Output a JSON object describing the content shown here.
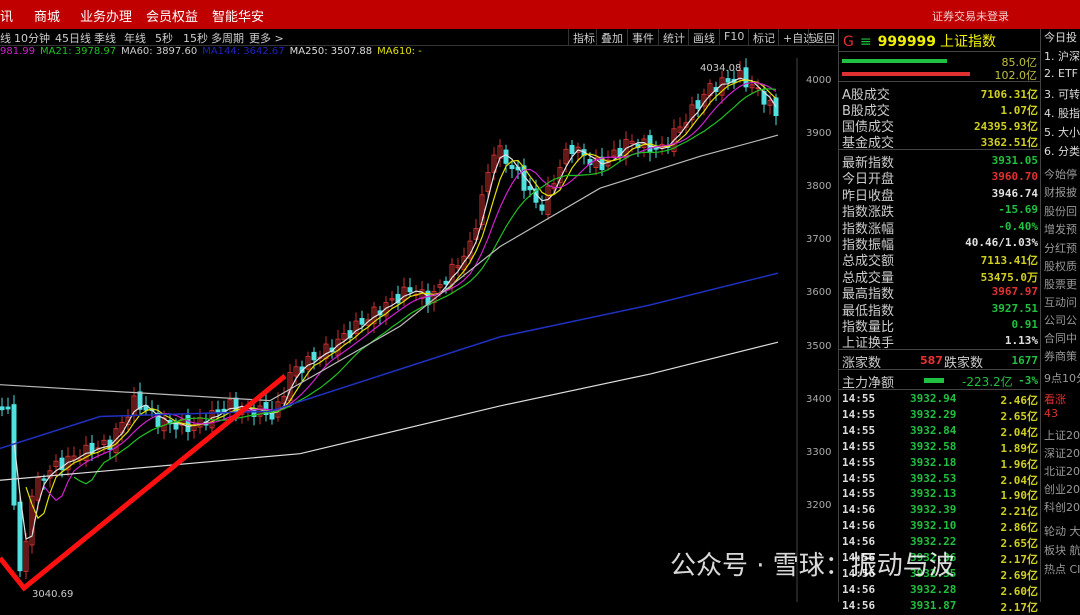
{
  "topbar": {
    "menu": [
      "讯",
      "商城",
      "业务办理",
      "会员权益",
      "智能华安"
    ],
    "login": "证券交易未登录"
  },
  "periods": [
    "线",
    "10分钟",
    "45日线",
    "季线",
    "年线",
    "5秒",
    "15秒",
    "多周期",
    "更多 >"
  ],
  "toolbar": [
    "指标",
    "叠加",
    "事件",
    "统计",
    "画线",
    "F10",
    "标记",
    "+自选",
    "返回"
  ],
  "ma_legend": [
    {
      "text": "981.99",
      "color": "#d020d0"
    },
    {
      "text": "MA21: 3978.97",
      "color": "#20c020"
    },
    {
      "text": "MA60: 3897.60",
      "color": "#cccccc"
    },
    {
      "text": "MA144: 3642.67",
      "color": "#2020c0"
    },
    {
      "text": "MA250: 3507.88",
      "color": "#dddddd"
    },
    {
      "text": "MA610: -",
      "color": "#e0e000"
    }
  ],
  "chart": {
    "y_ticks": [
      4000,
      3900,
      3800,
      3700,
      3600,
      3500,
      3400,
      3300,
      3200
    ],
    "high_label": "4034.08",
    "low_label": "3040.69",
    "anchors": [
      [
        0,
        3390
      ],
      [
        10,
        3370
      ],
      [
        18,
        3060
      ],
      [
        24,
        3100
      ],
      [
        32,
        3230
      ],
      [
        50,
        3270
      ],
      [
        80,
        3300
      ],
      [
        110,
        3320
      ],
      [
        135,
        3400
      ],
      [
        160,
        3360
      ],
      [
        190,
        3350
      ],
      [
        230,
        3390
      ],
      [
        260,
        3380
      ],
      [
        275,
        3370
      ],
      [
        290,
        3450
      ],
      [
        330,
        3500
      ],
      [
        370,
        3560
      ],
      [
        410,
        3610
      ],
      [
        430,
        3590
      ],
      [
        470,
        3690
      ],
      [
        495,
        3880
      ],
      [
        520,
        3820
      ],
      [
        540,
        3760
      ],
      [
        570,
        3880
      ],
      [
        600,
        3840
      ],
      [
        630,
        3890
      ],
      [
        660,
        3870
      ],
      [
        690,
        3940
      ],
      [
        710,
        3990
      ],
      [
        740,
        4010
      ],
      [
        760,
        3980
      ],
      [
        778,
        3935
      ]
    ],
    "ma_lines": {
      "ma60": [
        [
          0,
          3430
        ],
        [
          270,
          3400
        ],
        [
          400,
          3540
        ],
        [
          500,
          3690
        ],
        [
          600,
          3800
        ],
        [
          700,
          3860
        ],
        [
          778,
          3900
        ]
      ],
      "ma144": [
        [
          0,
          3310
        ],
        [
          100,
          3370
        ],
        [
          270,
          3380
        ],
        [
          500,
          3520
        ],
        [
          650,
          3580
        ],
        [
          778,
          3640
        ]
      ],
      "ma250": [
        [
          0,
          3250
        ],
        [
          300,
          3300
        ],
        [
          500,
          3390
        ],
        [
          650,
          3450
        ],
        [
          778,
          3510
        ]
      ]
    }
  },
  "quote": {
    "title_prefix": "G",
    "code": "999999",
    "name": "上证指数",
    "bar_green": "85.0亿",
    "bar_red": "102.0亿",
    "turnover": [
      [
        "A股成交",
        "7106.31亿"
      ],
      [
        "B股成交",
        "1.07亿"
      ],
      [
        "国债成交",
        "24395.93亿"
      ],
      [
        "基金成交",
        "3362.51亿"
      ]
    ],
    "stats": [
      [
        "最新指数",
        "3931.05",
        "#20c040"
      ],
      [
        "今日开盘",
        "3960.70",
        "#e03030"
      ],
      [
        "昨日收盘",
        "3946.74",
        "#e0e0e0"
      ],
      [
        "指数涨跌",
        "-15.69",
        "#20c040"
      ],
      [
        "指数涨幅",
        "-0.40%",
        "#20c040"
      ],
      [
        "指数振幅",
        "40.46/1.03%",
        "#e0e0e0"
      ],
      [
        "总成交额",
        "7113.41亿",
        "#d0d020"
      ],
      [
        "总成交量",
        "53475.0万",
        "#d0d020"
      ],
      [
        "最高指数",
        "3967.97",
        "#e03030"
      ],
      [
        "最低指数",
        "3927.51",
        "#20c040"
      ],
      [
        "指数量比",
        "0.91",
        "#20c040"
      ],
      [
        "上证换手",
        "1.13%",
        "#e0e0e0"
      ]
    ],
    "up_label": "涨家数",
    "up": "587",
    "down_label": "跌家数",
    "down": "1677",
    "main_label": "主力净额",
    "main_value": "-223.2亿",
    "main_pct": "-3%",
    "ticks": [
      [
        "14:55",
        "3932.94",
        "2.46亿"
      ],
      [
        "14:55",
        "3932.29",
        "2.65亿"
      ],
      [
        "14:55",
        "3932.84",
        "2.04亿"
      ],
      [
        "14:55",
        "3932.58",
        "1.89亿"
      ],
      [
        "14:55",
        "3932.18",
        "1.96亿"
      ],
      [
        "14:55",
        "3932.53",
        "2.04亿"
      ],
      [
        "14:55",
        "3932.13",
        "1.90亿"
      ],
      [
        "14:56",
        "3932.39",
        "2.21亿"
      ],
      [
        "14:56",
        "3932.10",
        "2.86亿"
      ],
      [
        "14:56",
        "3932.22",
        "2.65亿"
      ],
      [
        "14:56",
        "3932.36",
        "2.17亿"
      ],
      [
        "14:56",
        "3932.35",
        "2.69亿"
      ],
      [
        "14:56",
        "3932.28",
        "2.60亿"
      ],
      [
        "14:56",
        "3931.87",
        "2.17亿"
      ]
    ]
  },
  "far": {
    "items": [
      "今日投",
      "1. 沪深",
      "2. ETF",
      "3. 可转",
      "4. 股指",
      "5. 大小",
      "6. 分类",
      "今始停",
      "财报披",
      "股份回",
      "增发预",
      "分红预",
      "股权质",
      "股票更",
      "互动问",
      "公司公",
      "合同中",
      "券商策",
      "9点10分",
      "看涨",
      "43",
      "上证20",
      "深证20",
      "北证20",
      "创业20",
      "科创20",
      "轮动 大",
      "板块 航",
      "热点 CI"
    ]
  },
  "watermark": "公众号 · 雪球：振动与波"
}
